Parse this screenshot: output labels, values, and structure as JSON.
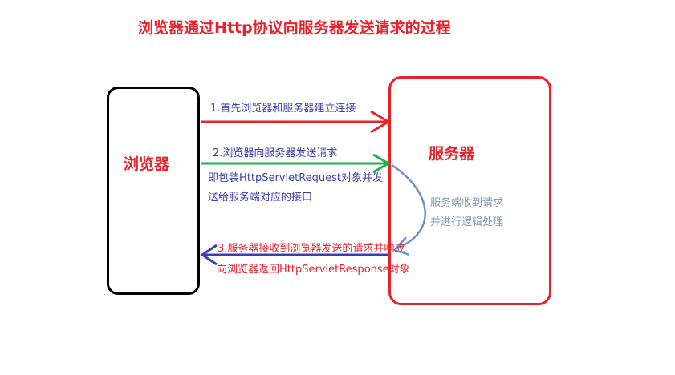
{
  "title": "浏览器通过Http协议向服务器发送请求的过程",
  "nodes": {
    "browser": "浏览器",
    "server": "服务器"
  },
  "steps": {
    "step1": "1.首先浏览器和服务器建立连接",
    "step2_line1": "2.浏览器向服务器发送请求",
    "step2_line2": "即包装HttpServletRequest对象并发",
    "step2_line3": "送给服务端对应的接口",
    "server_note_line1": "服务端收到请求",
    "server_note_line2": "并进行逻辑处理",
    "step3_line1": "3.服务器接收到浏览器发送的请求并响应",
    "step3_line2": "向浏览器返回HttpServletResponse对象"
  },
  "colors": {
    "red": "#e8222b",
    "green": "#22b14c",
    "blue": "#3b3fb0",
    "steel_blue": "#7092be",
    "black": "#000000"
  }
}
